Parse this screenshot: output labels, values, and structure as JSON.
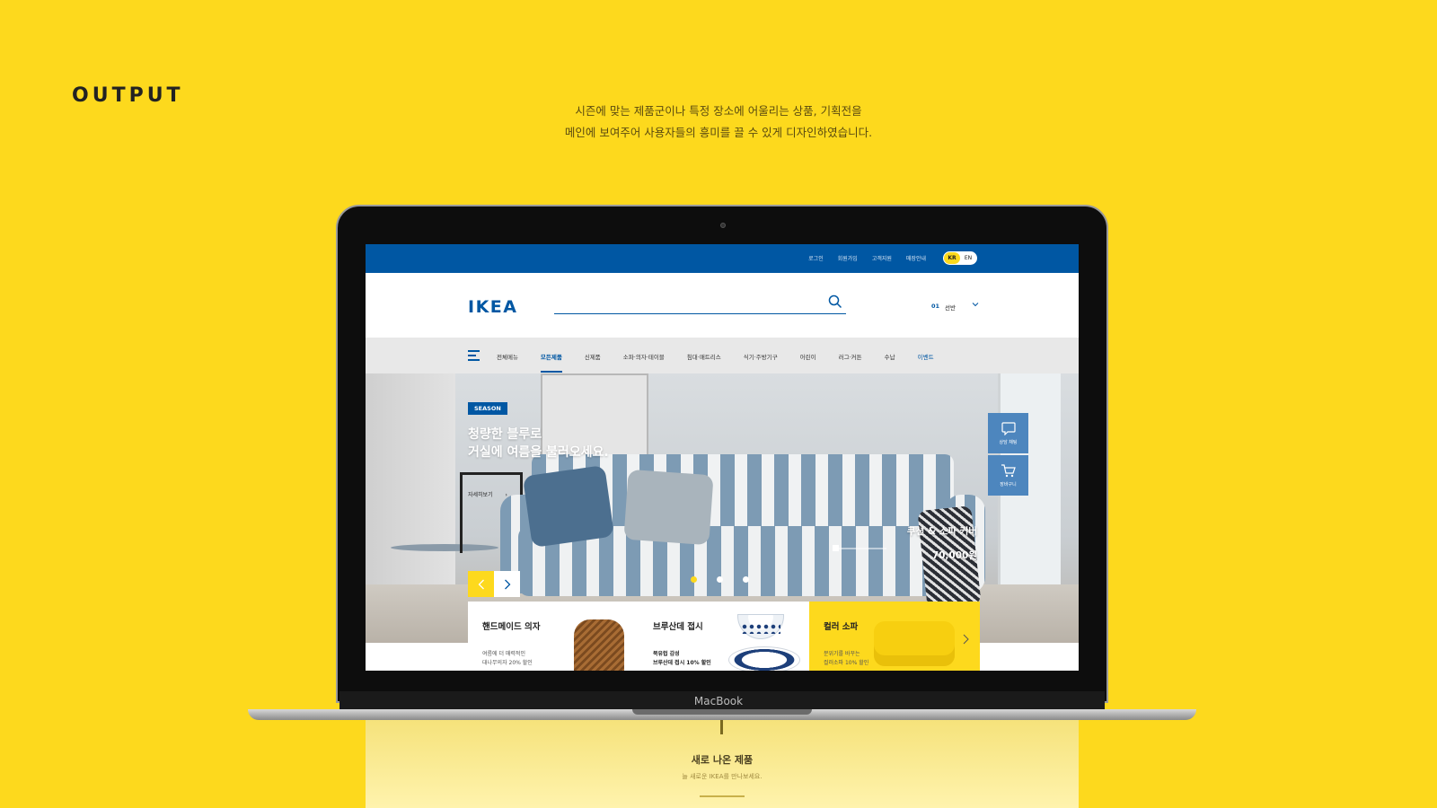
{
  "page": {
    "title": "OUTPUT",
    "desc_line1": "시즌에 맞는 제품군이나 특정 장소에 어울리는 상품, 기획전을",
    "desc_line2": "메인에 보여주어 사용자들의 흥미를 끌 수 있게 디자인하였습니다.",
    "laptop_label": "MacBook",
    "below_title": "새로 나온 제품",
    "below_subtitle": "늘 새로운 IKEA를 만나보세요."
  },
  "topbar": {
    "links": [
      "로그인",
      "회원가입",
      "고객지원",
      "매장안내"
    ],
    "lang_kr": "KR",
    "lang_en": "EN"
  },
  "header": {
    "logo": "IKEA",
    "search_placeholder": "",
    "store_num": "01",
    "store_name": "선반"
  },
  "nav": {
    "items": [
      "전체메뉴",
      "모든제품",
      "신제품",
      "소파·의자·테이블",
      "침대·매트리스",
      "식기·주방기구",
      "어린이",
      "러그·커튼",
      "수납",
      "이벤트"
    ],
    "active_index": 1
  },
  "hero": {
    "badge": "SEASON",
    "title_line1": "청량한 블루로",
    "title_line2": "거실에 여름을 불러오세요.",
    "more": "자세히보기",
    "product_name": "쿠션 & 소파 커버",
    "product_price": "70,000원",
    "slide_count": 3,
    "active_slide": 0,
    "chat_label": "상담 채팅",
    "cart_label": "장바구니"
  },
  "cards": [
    {
      "title": "핸드메이드 의자",
      "line1": "여름에 더 매력적인",
      "line2": "대나무의자 20% 할인"
    },
    {
      "title": "브루산데 접시",
      "line1": "북유럽 감성",
      "line2": "브루산데 접시 10% 할인"
    },
    {
      "title": "컬러 소파",
      "line1": "분위기를 바꾸는",
      "line2": "컬러소파 10% 할인"
    }
  ],
  "colors": {
    "background": "#fdd91d",
    "ikea_blue": "#0057a3",
    "ikea_yellow": "#fdd91d"
  }
}
